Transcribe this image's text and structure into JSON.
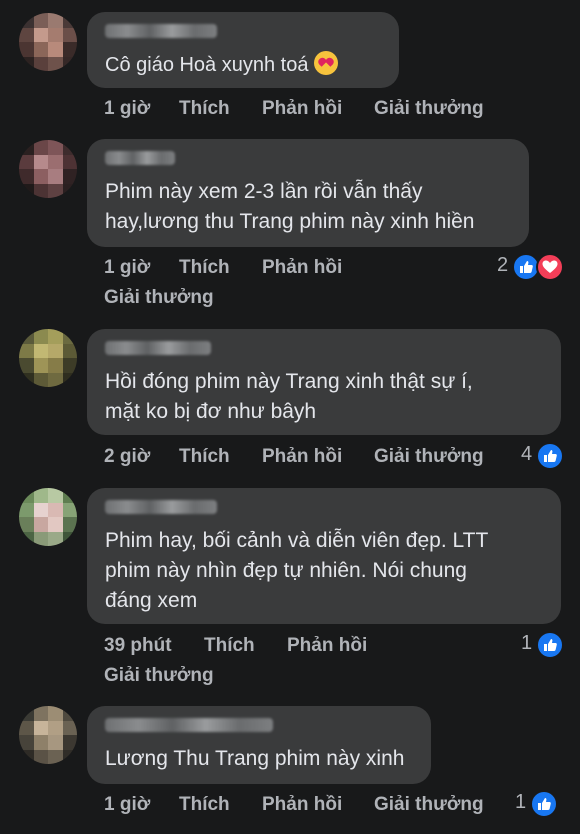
{
  "comments": [
    {
      "text": "Cô giáo Hoà xuynh toá",
      "emoji": "smiling-face-with-hearts",
      "time": "1 giờ",
      "like_label": "Thích",
      "reply_label": "Phản hồi",
      "award_label": "Giải thưởng",
      "reaction_count": ""
    },
    {
      "text": "Phim này xem 2-3 lần rồi vẫn thấy\nhay,lương thu Trang phim này xinh hiền",
      "time": "1 giờ",
      "like_label": "Thích",
      "reply_label": "Phản hồi",
      "award_label": "Giải thưởng",
      "reaction_count": "2"
    },
    {
      "text": "Hồi đóng phim này Trang xinh thật sự í,\nmặt ko bị đơ như bâyh",
      "time": "2 giờ",
      "like_label": "Thích",
      "reply_label": "Phản hồi",
      "award_label": "Giải thưởng",
      "reaction_count": "4"
    },
    {
      "text": "Phim hay, bối cảnh và diễn viên đẹp. LTT\nphim này nhìn đẹp tự nhiên. Nói chung\nđáng xem",
      "time": "39 phút",
      "like_label": "Thích",
      "reply_label": "Phản hồi",
      "award_label": "Giải thưởng",
      "reaction_count": "1"
    },
    {
      "text": "Lương Thu Trang phim này xinh",
      "time": "1 giờ",
      "like_label": "Thích",
      "reply_label": "Phản hồi",
      "award_label": "Giải thưởng",
      "reaction_count": "1"
    }
  ],
  "colors": {
    "background": "#18191a",
    "bubble": "#3a3b3c",
    "text": "#e4e6eb",
    "meta": "#b0b3b8",
    "like_blue": "#1877f2",
    "love_red": "#f33e58"
  }
}
